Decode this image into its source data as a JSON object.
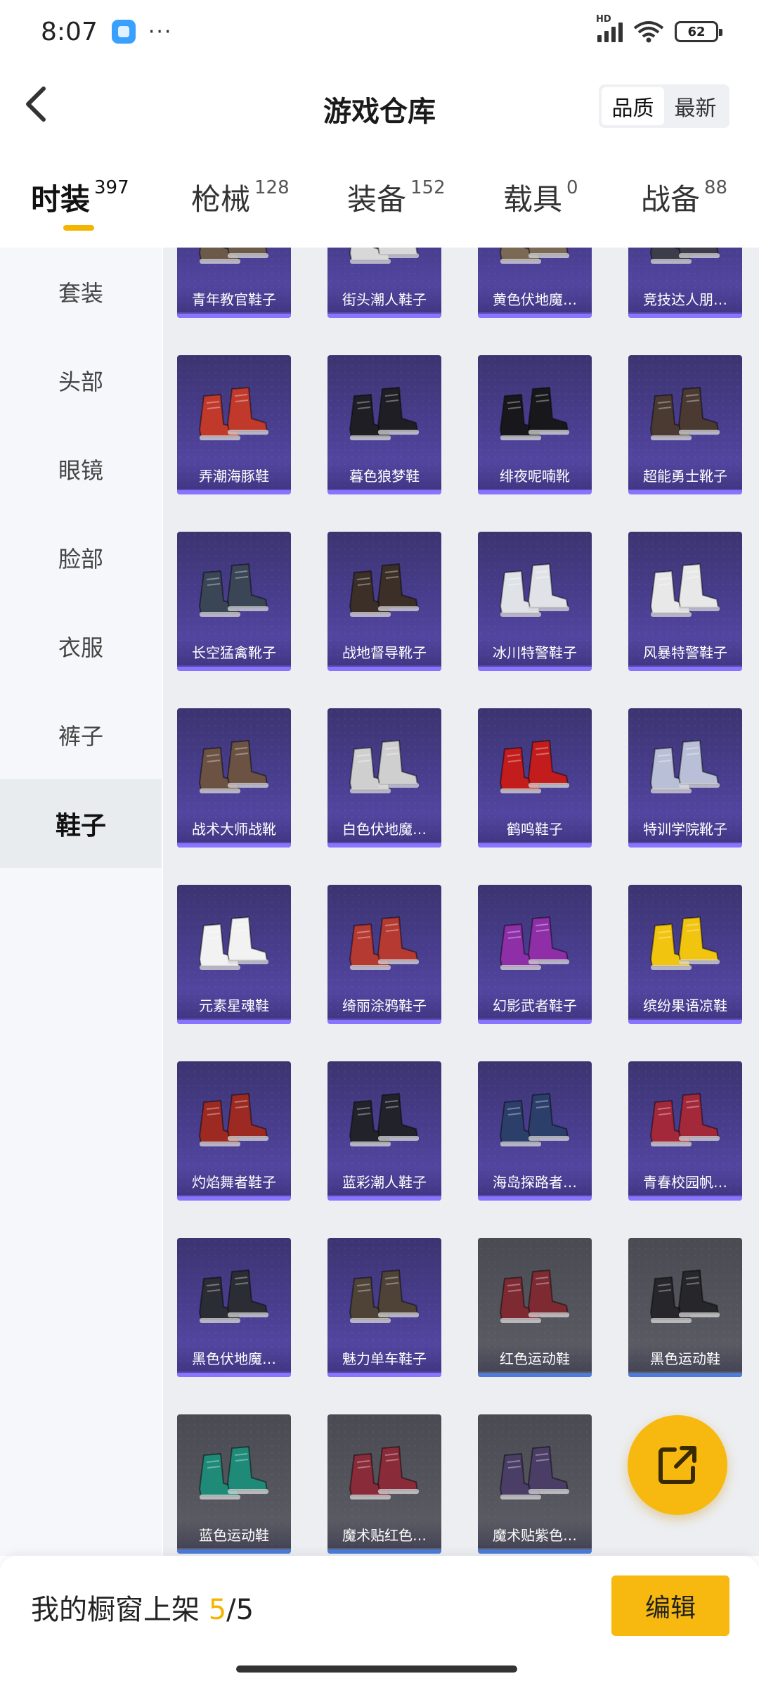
{
  "status_bar": {
    "time": "8:07",
    "dots": "···",
    "network": "HD",
    "battery": "62"
  },
  "header": {
    "title": "游戏仓库",
    "sort_options": [
      "品质",
      "最新"
    ],
    "sort_active": 0
  },
  "tabs": [
    {
      "label": "时装",
      "count": "397",
      "active": true
    },
    {
      "label": "枪械",
      "count": "128",
      "active": false
    },
    {
      "label": "装备",
      "count": "152",
      "active": false
    },
    {
      "label": "载具",
      "count": "0",
      "active": false
    },
    {
      "label": "战备",
      "count": "88",
      "active": false
    }
  ],
  "sidebar": {
    "items": [
      "套装",
      "头部",
      "眼镜",
      "脸部",
      "衣服",
      "裤子",
      "鞋子"
    ],
    "active_index": 6
  },
  "items": [
    {
      "name": "青年教官鞋子",
      "shoe_color": "#6b5a4a",
      "rarity": "purple"
    },
    {
      "name": "街头潮人鞋子",
      "shoe_color": "#d8d8d8",
      "rarity": "purple"
    },
    {
      "name": "黄色伏地魔…",
      "shoe_color": "#7a6a55",
      "rarity": "purple"
    },
    {
      "name": "竞技达人朋…",
      "shoe_color": "#3c3c4a",
      "rarity": "purple"
    },
    {
      "name": "弄潮海豚鞋",
      "shoe_color": "#c0392b",
      "rarity": "purple"
    },
    {
      "name": "暮色狼梦鞋",
      "shoe_color": "#1e1e24",
      "rarity": "purple"
    },
    {
      "name": "绯夜呢喃靴",
      "shoe_color": "#18181c",
      "rarity": "purple"
    },
    {
      "name": "超能勇士靴子",
      "shoe_color": "#4a3a32",
      "rarity": "purple"
    },
    {
      "name": "长空猛禽靴子",
      "shoe_color": "#3a4656",
      "rarity": "purple"
    },
    {
      "name": "战地督导靴子",
      "shoe_color": "#3b2f28",
      "rarity": "purple"
    },
    {
      "name": "冰川特警鞋子",
      "shoe_color": "#dfe3e8",
      "rarity": "purple"
    },
    {
      "name": "风暴特警鞋子",
      "shoe_color": "#e8e8e8",
      "rarity": "purple"
    },
    {
      "name": "战术大师战靴",
      "shoe_color": "#6b5243",
      "rarity": "purple"
    },
    {
      "name": "白色伏地魔…",
      "shoe_color": "#cfcfcf",
      "rarity": "purple"
    },
    {
      "name": "鹤鸣鞋子",
      "shoe_color": "#c21c1c",
      "rarity": "purple"
    },
    {
      "name": "特训学院靴子",
      "shoe_color": "#b9bfd6",
      "rarity": "purple"
    },
    {
      "name": "元素星魂鞋",
      "shoe_color": "#f2f2f2",
      "rarity": "purple"
    },
    {
      "name": "绮丽涂鸦鞋子",
      "shoe_color": "#b43a32",
      "rarity": "purple"
    },
    {
      "name": "幻影武者鞋子",
      "shoe_color": "#8e2fa8",
      "rarity": "purple"
    },
    {
      "name": "缤纷果语凉鞋",
      "shoe_color": "#f1c40f",
      "rarity": "purple"
    },
    {
      "name": "灼焰舞者鞋子",
      "shoe_color": "#9c2a22",
      "rarity": "purple"
    },
    {
      "name": "蓝彩潮人鞋子",
      "shoe_color": "#22222a",
      "rarity": "purple"
    },
    {
      "name": "海岛探路者…",
      "shoe_color": "#2c3f6b",
      "rarity": "purple"
    },
    {
      "name": "青春校园帆…",
      "shoe_color": "#a3283a",
      "rarity": "purple"
    },
    {
      "name": "黑色伏地魔…",
      "shoe_color": "#2a2d34",
      "rarity": "purple"
    },
    {
      "name": "魅力单车鞋子",
      "shoe_color": "#4f4338",
      "rarity": "purple"
    },
    {
      "name": "红色运动鞋",
      "shoe_color": "#7d2a33",
      "rarity": "gray"
    },
    {
      "name": "黑色运动鞋",
      "shoe_color": "#26262b",
      "rarity": "gray"
    },
    {
      "name": "蓝色运动鞋",
      "shoe_color": "#1f8a78",
      "rarity": "gray"
    },
    {
      "name": "魔术贴红色…",
      "shoe_color": "#8a2b3a",
      "rarity": "gray"
    },
    {
      "name": "魔术贴紫色…",
      "shoe_color": "#4a3e66",
      "rarity": "gray"
    }
  ],
  "bottom_bar": {
    "shelf_label": "我的橱窗上架 ",
    "shelf_count": "5",
    "shelf_total": "/5",
    "edit_label": "编辑"
  },
  "colors": {
    "accent": "#f5b400",
    "purple_card": "#4b3f92",
    "gray_card": "#55565e"
  }
}
